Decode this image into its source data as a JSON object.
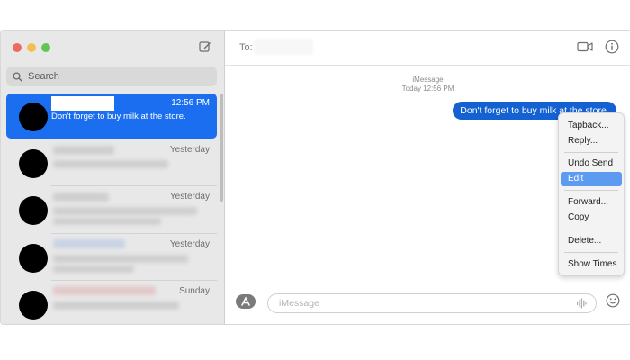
{
  "window": {
    "traffic_lights": {
      "close": "#ec6a5e",
      "minimize": "#f4bf4f",
      "zoom": "#61c554"
    },
    "icons": {
      "compose": "compose-icon"
    }
  },
  "sidebar": {
    "search_placeholder": "Search",
    "conversations": [
      {
        "time": "12:56 PM",
        "preview": "Don't forget to buy milk at the store.",
        "selected": true
      },
      {
        "time": "Yesterday",
        "preview": "",
        "selected": false
      },
      {
        "time": "Yesterday",
        "preview": "",
        "selected": false
      },
      {
        "time": "Yesterday",
        "preview": "",
        "selected": false
      },
      {
        "time": "Sunday",
        "preview": "",
        "selected": false
      }
    ]
  },
  "chat": {
    "to_label": "To:",
    "service": "iMessage",
    "timestamp": "Today 12:56 PM",
    "message": "Don't forget to buy milk at the store.",
    "input_placeholder": "iMessage",
    "bubble_color": "#1461d2",
    "icons": {
      "video": "video-camera-icon",
      "info": "info-icon",
      "apps": "app-store-icon",
      "audio": "audio-waveform-icon",
      "emoji": "emoji-icon"
    }
  },
  "context_menu": {
    "items": [
      "Tapback...",
      "Reply...",
      "Undo Send",
      "Edit",
      "Forward...",
      "Copy",
      "Delete...",
      "Show Times"
    ],
    "highlighted": "Edit",
    "highlight_color": "#5d9bf0"
  }
}
